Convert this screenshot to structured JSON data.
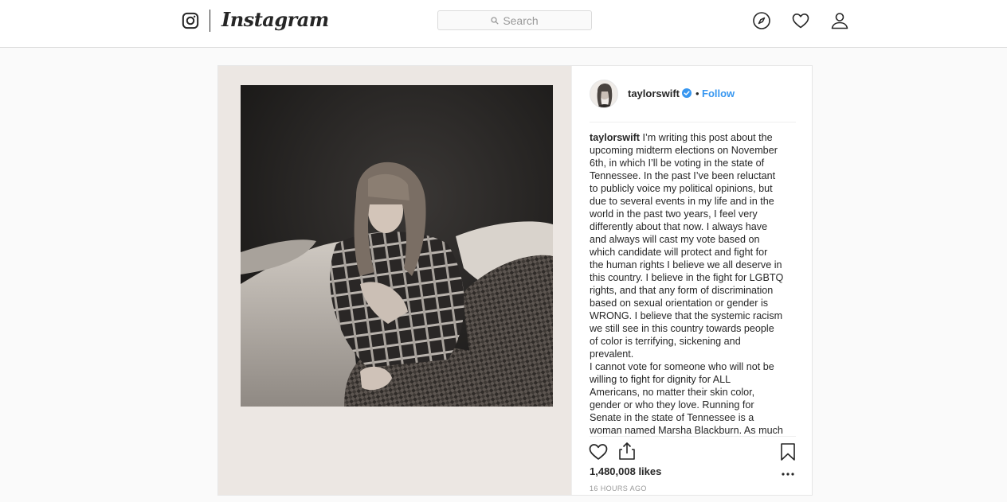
{
  "nav": {
    "wordmark": "Instagram",
    "search_placeholder": "Search",
    "icons": [
      "camera-logo-icon",
      "compass-icon",
      "heart-icon",
      "profile-icon"
    ]
  },
  "post": {
    "username": "taylorswift",
    "verified": true,
    "follow_label": "Follow",
    "separator": "•",
    "caption_username": "taylorswift",
    "caption_lines": [
      " I’m writing this post about the",
      "upcoming midterm elections on November",
      "6th, in which I’ll be voting in the state of",
      "Tennessee. In the past I’ve been reluctant",
      "to publicly voice my political opinions, but",
      "due to several events in my life and in the",
      "world in the past two years, I feel very",
      "differently about that now. I always have",
      "and always will cast my vote based on",
      "which candidate will protect and fight for",
      "the human rights I believe we all deserve in",
      "this country. I believe in the fight for LGBTQ",
      "rights, and that any form of discrimination",
      "based on sexual orientation or gender is",
      "WRONG. I believe that the systemic racism",
      "we still see in this country towards people",
      "of color is terrifying, sickening and",
      "prevalent.",
      "I cannot vote for someone who will not be",
      "willing to fight for dignity for ALL",
      "Americans, no matter their skin color,",
      "gender or who they love. Running for",
      "Senate in the state of Tennessee is a",
      "woman named Marsha Blackburn. As much"
    ],
    "likes": "1,480,008 likes",
    "timestamp": "16 HOURS AGO"
  },
  "colors": {
    "link_blue": "#3897f0",
    "text": "#262626",
    "muted": "#999999",
    "border": "#dbdbdb"
  }
}
